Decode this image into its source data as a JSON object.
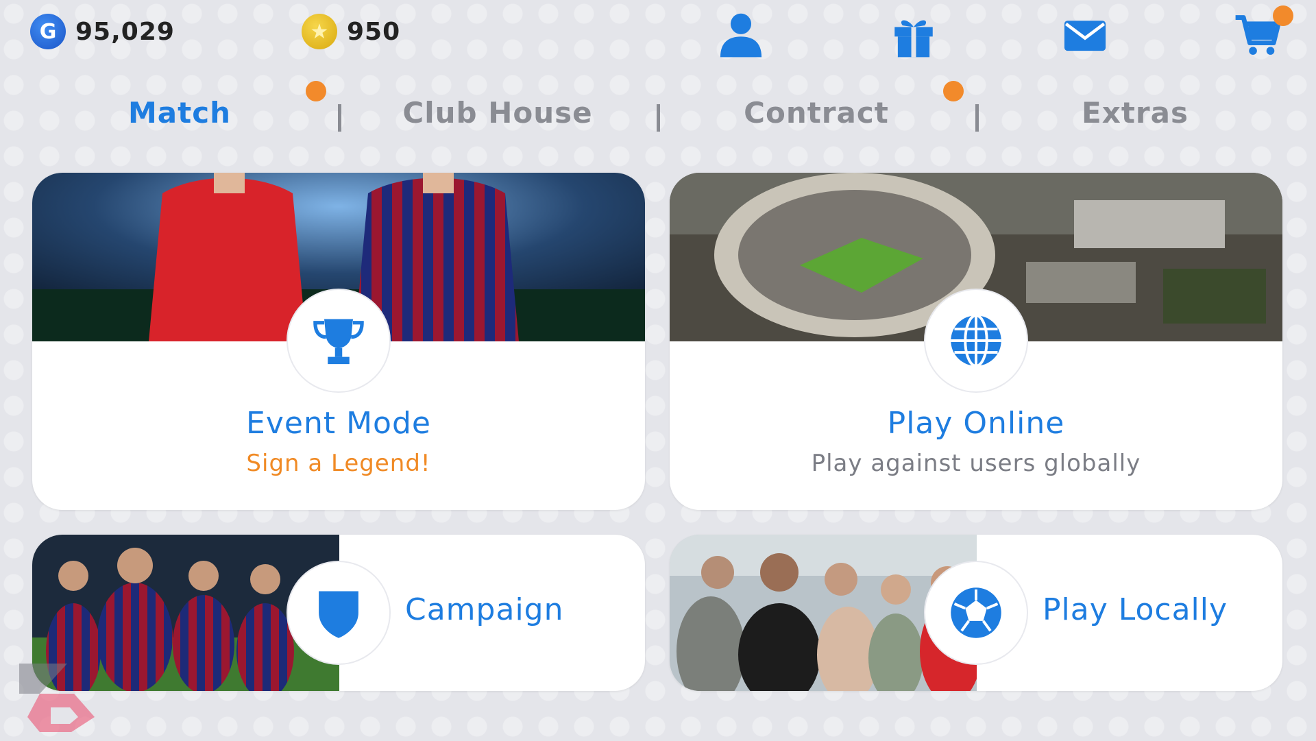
{
  "currencies": {
    "gp": {
      "icon": "gp-coin-icon",
      "symbol": "G",
      "value": "95,029"
    },
    "coins": {
      "icon": "star-coin-icon",
      "value": "950"
    }
  },
  "header_icons": [
    "user-icon",
    "gift-icon",
    "mail-icon",
    "cart-icon"
  ],
  "tabs": [
    {
      "label": "Match",
      "active": true
    },
    {
      "label": "Club House",
      "active": false
    },
    {
      "label": "Contract",
      "active": false
    },
    {
      "label": "Extras",
      "active": false
    }
  ],
  "cards": {
    "event_mode": {
      "title": "Event Mode",
      "subtitle": "Sign a Legend!",
      "icon": "trophy-icon"
    },
    "play_online": {
      "title": "Play Online",
      "subtitle": "Play against users globally",
      "icon": "globe-icon"
    },
    "campaign": {
      "title": "Campaign",
      "icon": "shield-icon"
    },
    "play_locally": {
      "title": "Play Locally",
      "icon": "soccer-ball-icon"
    }
  },
  "colors": {
    "accent": "#1e7de0",
    "notification": "#f28a2b",
    "subtitle_highlight": "#f08a25",
    "inactive_tab": "#8a8c93"
  }
}
